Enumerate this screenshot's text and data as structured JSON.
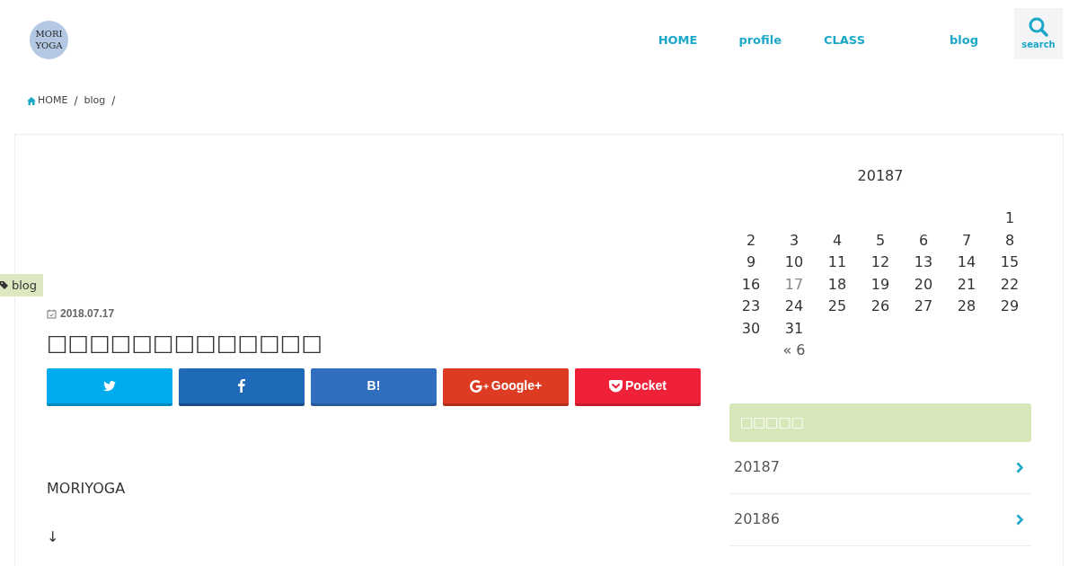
{
  "logo": {
    "lines": [
      "MORI",
      "YOGA"
    ]
  },
  "nav": [
    {
      "label": "HOME"
    },
    {
      "label": "profile"
    },
    {
      "label": "CLASS"
    },
    {
      "label": "blog"
    }
  ],
  "search_button": {
    "label": "search"
  },
  "breadcrumb": [
    {
      "label": "HOME",
      "kind": "home",
      "separator": "/"
    },
    {
      "label": "blog",
      "kind": "link",
      "separator": "/"
    }
  ],
  "category_tag": "blog",
  "post": {
    "date": "2018.07.17",
    "title": "□□□□□□□□□□□□□",
    "share_buttons": [
      {
        "kind": "twitter"
      },
      {
        "kind": "facebook"
      },
      {
        "kind": "hatena",
        "label": "B!"
      },
      {
        "kind": "google",
        "label": "Google+"
      },
      {
        "kind": "pocket",
        "label": "Pocket"
      }
    ],
    "body": [
      "MORIYOGA",
      "↓"
    ]
  },
  "calendar": {
    "caption": "20187",
    "weeks": [
      [
        {
          "day": "1",
          "has_post": false
        }
      ],
      [
        {
          "day": "2",
          "has_post": false
        },
        {
          "day": "3",
          "has_post": false
        },
        {
          "day": "4",
          "has_post": false
        },
        {
          "day": "5",
          "has_post": false
        },
        {
          "day": "6",
          "has_post": false
        },
        {
          "day": "7",
          "has_post": false
        },
        {
          "day": "8",
          "has_post": false
        }
      ],
      [
        {
          "day": "9",
          "has_post": false
        },
        {
          "day": "10",
          "has_post": false
        },
        {
          "day": "11",
          "has_post": false
        },
        {
          "day": "12",
          "has_post": false
        },
        {
          "day": "13",
          "has_post": false
        },
        {
          "day": "14",
          "has_post": false
        },
        {
          "day": "15",
          "has_post": false
        }
      ],
      [
        {
          "day": "16",
          "has_post": false
        },
        {
          "day": "17",
          "has_post": true
        },
        {
          "day": "18",
          "has_post": false
        },
        {
          "day": "19",
          "has_post": false
        },
        {
          "day": "20",
          "has_post": false
        },
        {
          "day": "21",
          "has_post": false
        },
        {
          "day": "22",
          "has_post": false
        }
      ],
      [
        {
          "day": "23",
          "has_post": false
        },
        {
          "day": "24",
          "has_post": false
        },
        {
          "day": "25",
          "has_post": false
        },
        {
          "day": "26",
          "has_post": false
        },
        {
          "day": "27",
          "has_post": false
        },
        {
          "day": "28",
          "has_post": false
        },
        {
          "day": "29",
          "has_post": false
        }
      ],
      [
        {
          "day": "30",
          "has_post": false
        },
        {
          "day": "31",
          "has_post": false
        }
      ]
    ],
    "prev_link": "« 6"
  },
  "archive": {
    "heading": "□□□□□",
    "items": [
      "20187",
      "20186"
    ]
  }
}
